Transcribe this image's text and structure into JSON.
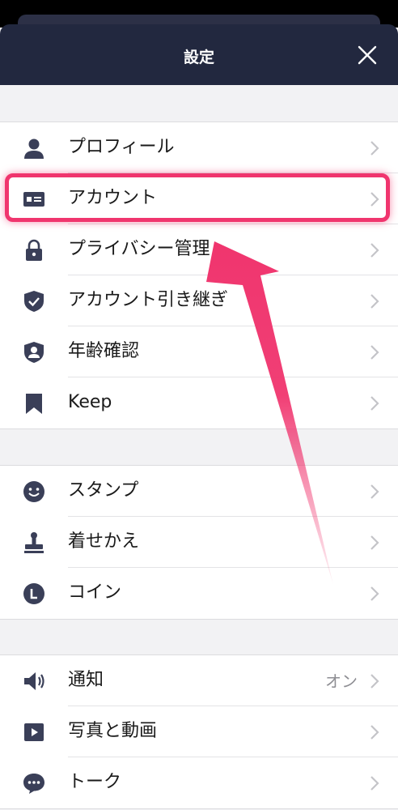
{
  "header": {
    "title": "設定"
  },
  "sections": [
    [
      {
        "label": "プロフィール",
        "icon": "person-icon"
      },
      {
        "label": "アカウント",
        "icon": "id-card-icon"
      },
      {
        "label": "プライバシー管理",
        "icon": "lock-icon"
      },
      {
        "label": "アカウント引き継ぎ",
        "icon": "shield-check-icon"
      },
      {
        "label": "年齢確認",
        "icon": "age-verify-icon"
      },
      {
        "label": "Keep",
        "icon": "bookmark-icon"
      }
    ],
    [
      {
        "label": "スタンプ",
        "icon": "smiley-icon"
      },
      {
        "label": "着せかえ",
        "icon": "stamp-icon"
      },
      {
        "label": "コイン",
        "icon": "coin-icon"
      }
    ],
    [
      {
        "label": "通知",
        "icon": "speaker-icon",
        "value": "オン"
      },
      {
        "label": "写真と動画",
        "icon": "play-icon"
      },
      {
        "label": "トーク",
        "icon": "chat-bubble-icon"
      }
    ]
  ],
  "colors": {
    "header_bg": "#22283f",
    "icon": "#3a3f58",
    "highlight": "#f0356e"
  }
}
